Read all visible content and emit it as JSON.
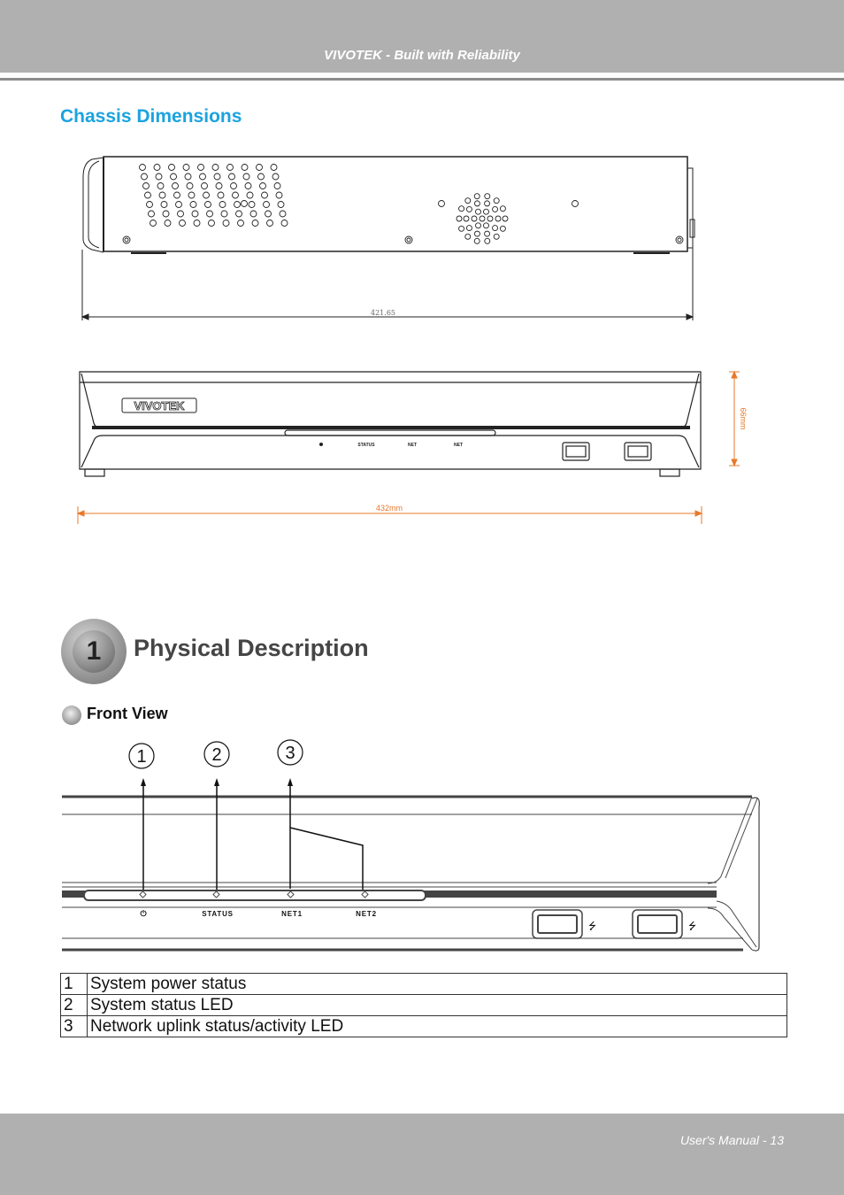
{
  "header": {
    "tagline": "VIVOTEK - Built with Reliability"
  },
  "chassis": {
    "title": "Chassis Dimensions",
    "side_view": {
      "depth_label": "421.65"
    },
    "front_view": {
      "brand_logo": "VIVOTEK",
      "led_labels": [
        "STATUS",
        "NET",
        "NET"
      ],
      "width_label": "432mm",
      "height_label": "66mm",
      "dimension_color": "#e8792b"
    }
  },
  "chapter": {
    "number": "1",
    "title": "Physical Description"
  },
  "front_view_section": {
    "title": "Front View",
    "callouts": [
      "1",
      "2",
      "3"
    ],
    "panel_labels": {
      "power_icon": "⏻",
      "status": "STATUS",
      "net1": "NET1",
      "net2": "NET2"
    }
  },
  "legend_table": {
    "rows": [
      {
        "num": "1",
        "desc": "System power status"
      },
      {
        "num": "2",
        "desc": "System status LED"
      },
      {
        "num": "3",
        "desc": "Network uplink status/activity LED"
      }
    ]
  },
  "footer": {
    "page_label": "User's Manual - 13"
  }
}
